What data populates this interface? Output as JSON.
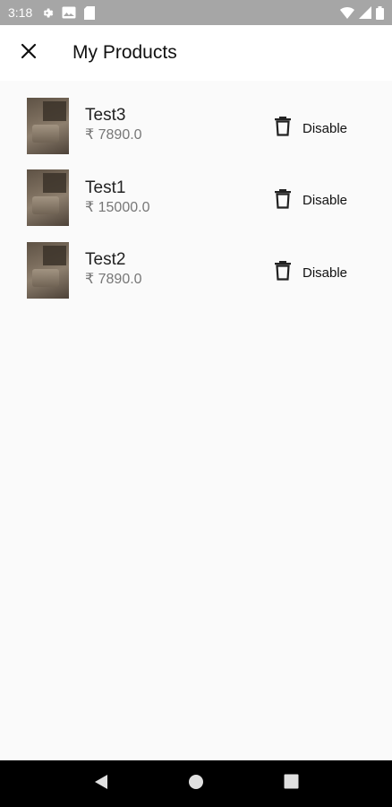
{
  "status_bar": {
    "time": "3:18",
    "icons": [
      "gear-icon",
      "photo-icon",
      "sd-card-icon",
      "wifi-icon",
      "signal-icon",
      "battery-icon"
    ]
  },
  "app_bar": {
    "title": "My Products",
    "close_icon": "close-icon"
  },
  "products": [
    {
      "name": "Test3",
      "price": "₹ 7890.0",
      "action_label": "Disable",
      "action_icon": "trash-icon"
    },
    {
      "name": "Test1",
      "price": "₹ 15000.0",
      "action_label": "Disable",
      "action_icon": "trash-icon"
    },
    {
      "name": "Test2",
      "price": "₹ 7890.0",
      "action_label": "Disable",
      "action_icon": "trash-icon"
    }
  ],
  "nav_bar": {
    "buttons": [
      "back-icon",
      "home-icon",
      "recents-icon"
    ]
  },
  "colors": {
    "status_bar": "#a6a6a6",
    "app_bar": "#ffffff",
    "background": "#fafafa",
    "nav_bar": "#000000"
  }
}
